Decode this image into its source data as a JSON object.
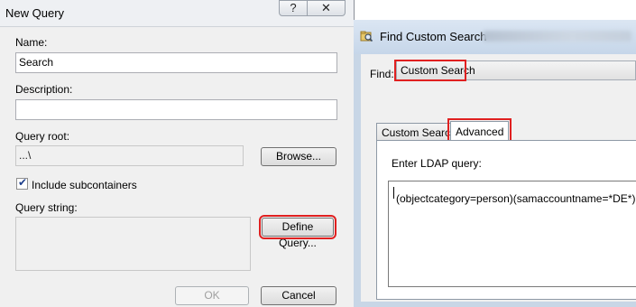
{
  "new_query": {
    "title": "New Query",
    "help_label": "?",
    "close_label": "✕",
    "name_label": "Name:",
    "name_value": "Search",
    "description_label": "Description:",
    "description_value": "",
    "query_root_label": "Query root:",
    "query_root_value": "...\\",
    "browse_label": "Browse...",
    "include_subcontainers_label": "Include subcontainers",
    "include_subcontainers_checked": true,
    "query_string_label": "Query string:",
    "query_string_value": "",
    "define_query_label": "Define Query...",
    "ok_label": "OK",
    "cancel_label": "Cancel"
  },
  "find_custom_search": {
    "title": "Find Custom Search",
    "find_label": "Find:",
    "find_value": "Custom Search",
    "tabs": [
      {
        "label": "Custom Search",
        "active": false
      },
      {
        "label": "Advanced",
        "active": true
      }
    ],
    "ldap_label": "Enter LDAP query:",
    "ldap_value": "(objectcategory=person)(samaccountname=*DE*)"
  },
  "colors": {
    "highlight": "#e02020",
    "checkmark": "#1e3f8c",
    "titlebar_blue": "#c6d6e9"
  }
}
